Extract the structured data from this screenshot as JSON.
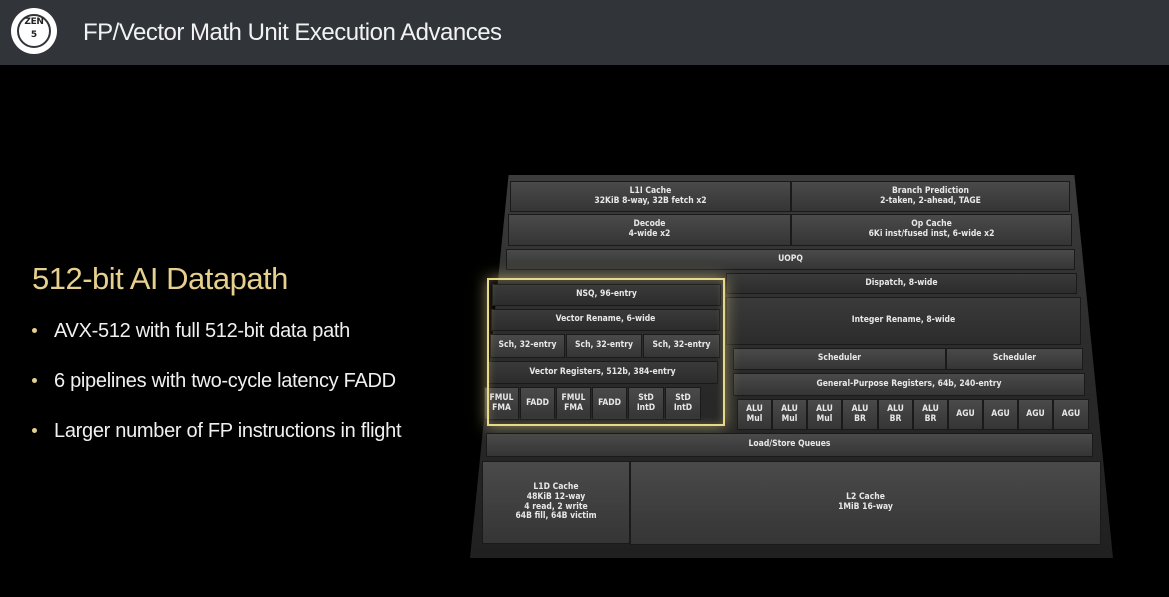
{
  "header": {
    "logo_text": "ZEN",
    "logo_number": "5",
    "title": "FP/Vector Math Unit Execution Advances"
  },
  "content": {
    "heading": "512-bit AI Datapath",
    "bullets": [
      "AVX-512 with full 512-bit data path",
      "6 pipelines with two-cycle latency FADD",
      "Larger number of FP instructions in flight"
    ]
  },
  "diagram": {
    "l1i": [
      "L1I Cache",
      "32KiB 8-way, 32B fetch x2"
    ],
    "branch": [
      "Branch Prediction",
      "2-taken, 2-ahead, TAGE"
    ],
    "decode": [
      "Decode",
      "4-wide x2"
    ],
    "opcache": [
      "Op Cache",
      "6Ki inst/fused inst, 6-wide x2"
    ],
    "uopq": "UOPQ",
    "dispatch": "Dispatch, 8-wide",
    "nsq": "NSQ, 96-entry",
    "vec_rename": "Vector Rename, 6-wide",
    "int_rename": "Integer Rename, 8-wide",
    "sch1": "Sch, 32-entry",
    "sch2": "Sch, 32-entry",
    "sch3": "Sch, 32-entry",
    "scheduler1": "Scheduler",
    "scheduler2": "Scheduler",
    "vec_regs": "Vector Registers, 512b, 384-entry",
    "gp_regs": "General-Purpose Registers, 64b, 240-entry",
    "fp_units": [
      [
        "FMUL",
        "FMA"
      ],
      [
        "FADD",
        ""
      ],
      [
        "FMUL",
        "FMA"
      ],
      [
        "FADD",
        ""
      ],
      [
        "StD",
        "IntD"
      ],
      [
        "StD",
        "IntD"
      ]
    ],
    "int_units": [
      [
        "ALU",
        "Mul"
      ],
      [
        "ALU",
        "Mul"
      ],
      [
        "ALU",
        "Mul"
      ],
      [
        "ALU",
        "BR"
      ],
      [
        "ALU",
        "BR"
      ],
      [
        "ALU",
        "BR"
      ],
      [
        "AGU",
        ""
      ],
      [
        "AGU",
        ""
      ],
      [
        "AGU",
        ""
      ],
      [
        "AGU",
        ""
      ]
    ],
    "lsq": "Load/Store Queues",
    "l1d": [
      "L1D Cache",
      "48KiB 12-way",
      "4 read, 2 write",
      "64B fill, 64B victim"
    ],
    "l2": [
      "L2 Cache",
      "1MiB 16-way"
    ]
  }
}
